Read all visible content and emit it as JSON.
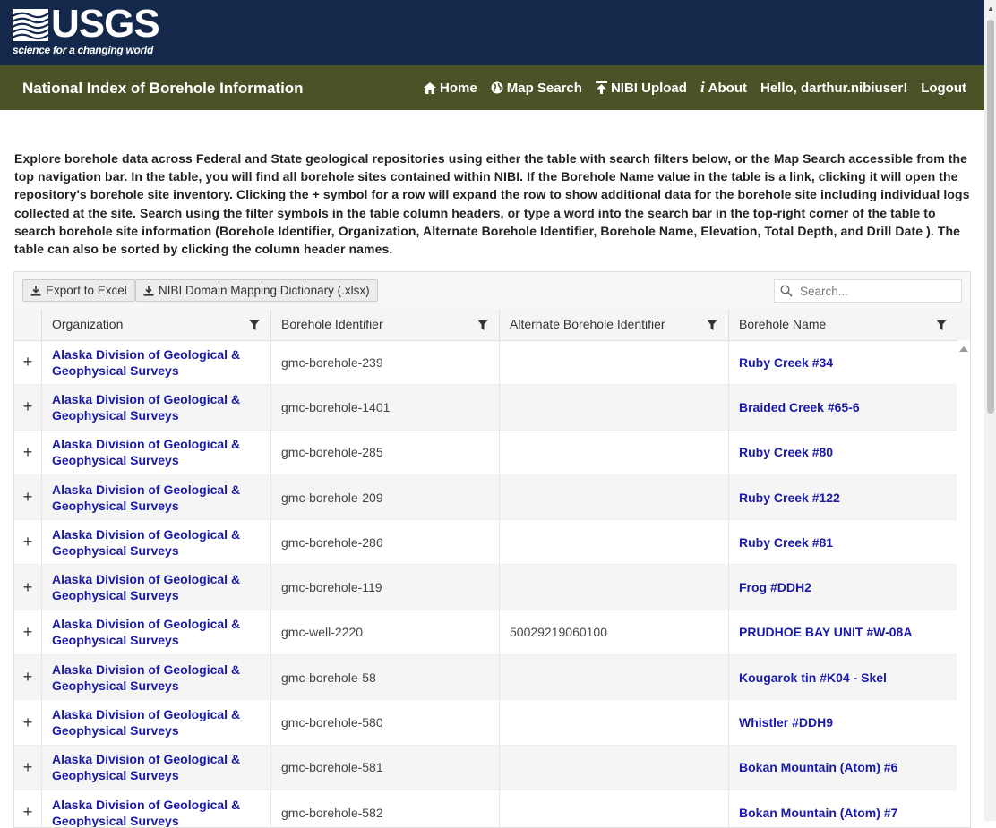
{
  "header": {
    "logo_word": "USGS",
    "logo_tagline": "science for a changing world",
    "site_title": "National Index of Borehole Information",
    "nav": [
      {
        "label": "Home",
        "icon": "home-icon"
      },
      {
        "label": "Map Search",
        "icon": "globe-icon"
      },
      {
        "label": "NIBI Upload",
        "icon": "upload-icon"
      },
      {
        "label": "About",
        "icon": "info-icon"
      },
      {
        "label": "Hello, darthur.nibiuser!",
        "icon": ""
      },
      {
        "label": "Logout",
        "icon": ""
      }
    ]
  },
  "intro": "Explore borehole data across Federal and State geological repositories using either the table with search filters below, or the Map Search accessible from the top navigation bar. In the table, you will find all borehole sites contained within NIBI. If the Borehole Name value in the table is a link, clicking it will open the repository's borehole site inventory. Clicking the + symbol for a row will expand the row to show additional data for the borehole site including individual logs collected at the site. Search using the filter symbols in the table column headers, or type a word into the search bar in the top-right corner of the table to search borehole site information (Borehole Identifier, Organization, Alternate Borehole Identifier, Borehole Name, Elevation, Total Depth, and Drill Date ). The table can also be sorted by clicking the column header names.",
  "toolbar": {
    "export_label": "Export to Excel",
    "dictionary_label": "NIBI Domain Mapping Dictionary (.xlsx)",
    "search_placeholder": "Search..."
  },
  "table": {
    "columns": [
      "Organization",
      "Borehole Identifier",
      "Alternate Borehole Identifier",
      "Borehole Name"
    ],
    "expand_symbol": "+",
    "rows": [
      {
        "org1": "Alaska Division of Geological &",
        "org2": "Geophysical Surveys",
        "id": "gmc-borehole-239",
        "alt": "",
        "name": "Ruby Creek #34"
      },
      {
        "org1": "Alaska Division of Geological &",
        "org2": "Geophysical Surveys",
        "id": "gmc-borehole-1401",
        "alt": "",
        "name": "Braided Creek #65-6"
      },
      {
        "org1": "Alaska Division of Geological &",
        "org2": "Geophysical Surveys",
        "id": "gmc-borehole-285",
        "alt": "",
        "name": "Ruby Creek #80"
      },
      {
        "org1": "Alaska Division of Geological &",
        "org2": "Geophysical Surveys",
        "id": "gmc-borehole-209",
        "alt": "",
        "name": "Ruby Creek #122"
      },
      {
        "org1": "Alaska Division of Geological &",
        "org2": "Geophysical Surveys",
        "id": "gmc-borehole-286",
        "alt": "",
        "name": "Ruby Creek #81"
      },
      {
        "org1": "Alaska Division of Geological &",
        "org2": "Geophysical Surveys",
        "id": "gmc-borehole-119",
        "alt": "",
        "name": "Frog #DDH2"
      },
      {
        "org1": "Alaska Division of Geological &",
        "org2": "Geophysical Surveys",
        "id": "gmc-well-2220",
        "alt": "50029219060100",
        "name": "PRUDHOE BAY UNIT #W-08A"
      },
      {
        "org1": "Alaska Division of Geological &",
        "org2": "Geophysical Surveys",
        "id": "gmc-borehole-58",
        "alt": "",
        "name": "Kougarok tin #K04 - Skel"
      },
      {
        "org1": "Alaska Division of Geological &",
        "org2": "Geophysical Surveys",
        "id": "gmc-borehole-580",
        "alt": "",
        "name": "Whistler #DDH9"
      },
      {
        "org1": "Alaska Division of Geological &",
        "org2": "Geophysical Surveys",
        "id": "gmc-borehole-581",
        "alt": "",
        "name": "Bokan Mountain (Atom) #6"
      },
      {
        "org1": "Alaska Division of Geological &",
        "org2": "Geophysical Surveys",
        "id": "gmc-borehole-582",
        "alt": "",
        "name": "Bokan Mountain (Atom) #7"
      }
    ]
  }
}
